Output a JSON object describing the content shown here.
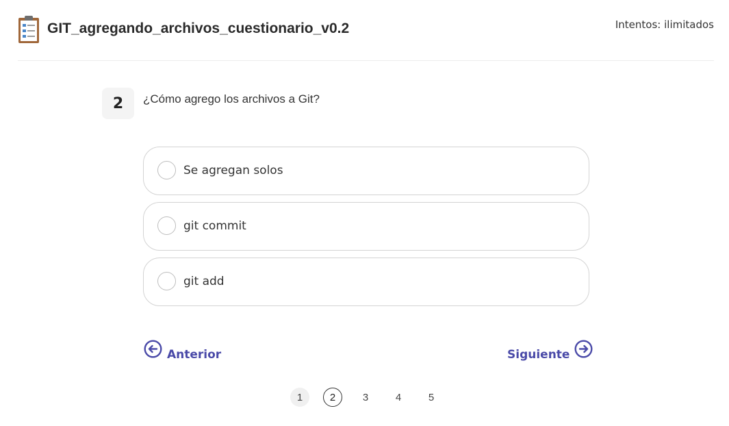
{
  "header": {
    "title": "GIT_agregando_archivos_cuestionario_v0.2",
    "attempts": "Intentos: ilimitados",
    "icon": "clipboard-checklist-icon"
  },
  "question": {
    "number": "2",
    "text": "¿Cómo agrego los archivos a Git?"
  },
  "options": [
    {
      "label": "Se agregan solos",
      "selected": false
    },
    {
      "label": "git commit",
      "selected": false
    },
    {
      "label": "git add",
      "selected": false
    }
  ],
  "navigation": {
    "previous_label": "Anterior",
    "next_label": "Siguiente",
    "accent_color": "#4a4aa8"
  },
  "pagination": {
    "pages": [
      "1",
      "2",
      "3",
      "4",
      "5"
    ],
    "current": "2"
  }
}
